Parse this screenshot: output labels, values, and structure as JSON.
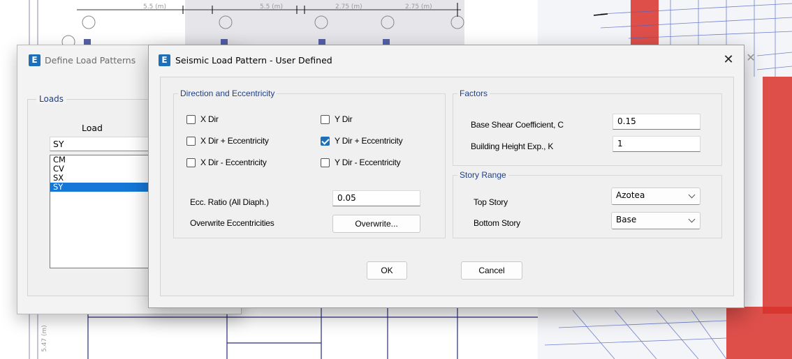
{
  "background": {
    "plan_dimensions": [
      "5.5 (m)",
      "5.5 (m)",
      "2.75 (m)",
      "2.75 (m)"
    ],
    "plan_side_dim": "5.47 (m)"
  },
  "define_window": {
    "title": "Define Load Patterns",
    "loads_group": "Loads",
    "load_col_label": "Load",
    "load_value": "SY",
    "load_list": [
      "CM",
      "CV",
      "SX",
      "SY"
    ],
    "selected_index": 3
  },
  "dialog": {
    "title": "Seismic Load Pattern - User Defined",
    "app_icon": "E",
    "close_label": "✕",
    "direction_group": {
      "legend": "Direction and Eccentricity",
      "options": [
        {
          "label": "X Dir",
          "checked": false
        },
        {
          "label": "Y Dir",
          "checked": false
        },
        {
          "label": "X Dir + Eccentricity",
          "checked": false
        },
        {
          "label": "Y Dir + Eccentricity",
          "checked": true
        },
        {
          "label": "X Dir - Eccentricity",
          "checked": false
        },
        {
          "label": "Y Dir - Eccentricity",
          "checked": false
        }
      ],
      "ecc_ratio_label": "Ecc. Ratio (All Diaph.)",
      "ecc_ratio_value": "0.05",
      "overwrite_label": "Overwrite Eccentricities",
      "overwrite_button": "Overwrite..."
    },
    "factors_group": {
      "legend": "Factors",
      "base_shear_label": "Base Shear Coefficient, C",
      "base_shear_value": "0.15",
      "height_exp_label": "Building Height Exp., K",
      "height_exp_value": "1"
    },
    "story_range_group": {
      "legend": "Story Range",
      "top_story_label": "Top Story",
      "top_story_value": "Azotea",
      "bottom_story_label": "Bottom Story",
      "bottom_story_value": "Base"
    },
    "ok_button": "OK",
    "cancel_button": "Cancel"
  },
  "colors": {
    "accent": "#1f6fb8",
    "group_legend": "#1e3f86",
    "selection": "#1578d6",
    "structure_red": "#d9312b"
  }
}
